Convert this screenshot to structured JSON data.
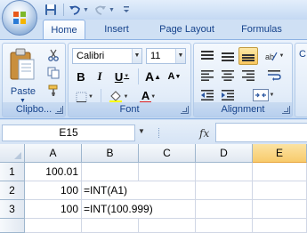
{
  "quick_access": {
    "icons": [
      "office-logo-icon",
      "save-icon",
      "undo-icon",
      "redo-icon",
      "customize-arrow-icon"
    ]
  },
  "tabs": {
    "home": "Home",
    "insert": "Insert",
    "page_layout": "Page Layout",
    "formulas": "Formulas"
  },
  "clipboard": {
    "group_label": "Clipbo...",
    "paste_label": "Paste"
  },
  "font": {
    "group_label": "Font",
    "font_name": "Calibri",
    "font_size": "11",
    "bold_label": "B",
    "italic_label": "I",
    "underline_label": "U",
    "grow_label": "A",
    "shrink_label": "A",
    "font_color_label": "A",
    "font_color": "#e02020",
    "fill_color": "#ffff00"
  },
  "alignment": {
    "group_label": "Alignment",
    "selected": "align-bottom"
  },
  "next_group_partial": "C",
  "formula_bar": {
    "name_box": "E15",
    "fx_label": "fx",
    "formula": ""
  },
  "grid": {
    "columns": [
      "A",
      "B",
      "C",
      "D",
      "E"
    ],
    "selected_column": "E",
    "rows": [
      {
        "header": "1",
        "A": "100.01",
        "B": ""
      },
      {
        "header": "2",
        "A": "100",
        "B": "=INT(A1)"
      },
      {
        "header": "3",
        "A": "100",
        "B": "=INT(100.999)"
      }
    ]
  },
  "colors": {
    "ribbon_bg": "#dbe8f7",
    "accent": "#15428b",
    "selection": "#f9c75f"
  }
}
